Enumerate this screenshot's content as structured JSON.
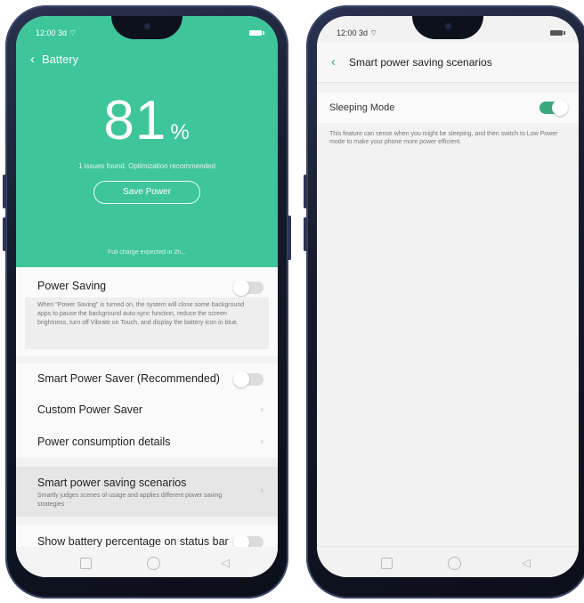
{
  "status_bar": {
    "time": "12:00 3d ⌔"
  },
  "left_screen": {
    "header_title": "Battery",
    "battery_percent": "81",
    "battery_unit": "%",
    "issues_text": "1 issues found. Optimization recommended",
    "save_power_label": "Save Power",
    "full_charge_text": "Full charge expected in 2h...",
    "power_saving": {
      "label": "Power Saving",
      "enabled": false,
      "description": "When \"Power Saving\" is turned on, the system will close some background apps to pause the background auto-sync function, reduce the screen brightness, turn off Vibrate on Touch, and display the battery icon in blue."
    },
    "smart_power_saver": {
      "label": "Smart Power Saver (Recommended)",
      "enabled": false
    },
    "custom_power_saver": {
      "label": "Custom Power Saver"
    },
    "power_consumption": {
      "label": "Power consumption details"
    },
    "smart_scenarios": {
      "label": "Smart power saving scenarios",
      "description": "Smartly judges scenes of usage and applies different power saving strategies"
    },
    "show_percentage": {
      "label": "Show battery percentage on status bar",
      "enabled": false
    }
  },
  "right_screen": {
    "header_title": "Smart power saving scenarios",
    "sleeping_mode": {
      "label": "Sleeping Mode",
      "enabled": true
    },
    "description": "This feature can sense when you might be sleeping, and then switch to Low Power mode to make your phone more power efficient."
  },
  "colors": {
    "accent": "#3ec59a",
    "toggle_on": "#3aa97d"
  }
}
